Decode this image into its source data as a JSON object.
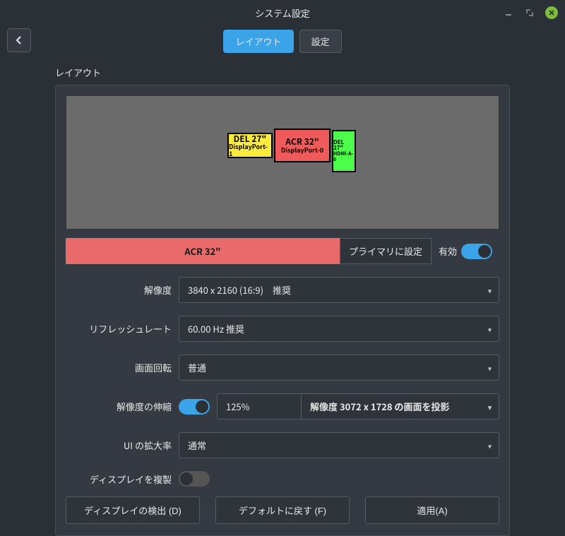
{
  "window": {
    "title": "システム設定"
  },
  "tabs": {
    "layout": "レイアウト",
    "settings": "設定",
    "back_aria": "戻る"
  },
  "section": {
    "layout_title": "レイアウト"
  },
  "monitors": {
    "del27_dp1": {
      "name": "DEL 27\"",
      "port": "DisplayPort-1"
    },
    "acr32": {
      "name": "ACR 32\"",
      "port": "DisplayPort-0"
    },
    "del27_hdmi": {
      "name": "DEL 27\"",
      "port": "HDMI-A-0"
    }
  },
  "selected": {
    "display": "ACR 32\"",
    "set_primary_label": "プライマリに設定",
    "enabled_label": "有効",
    "enabled": true
  },
  "form": {
    "resolution_label": "解像度",
    "resolution_value": "3840 x 2160 (16:9)　推奨",
    "refresh_label": "リフレッシュレート",
    "refresh_value": "60.00 Hz  推奨",
    "rotation_label": "画面回転",
    "rotation_value": "普通",
    "scale_label": "解像度の伸縮",
    "scale_enabled": true,
    "scale_pct": "125%",
    "scale_hint": "解像度 3072 x 1728 の画面を投影",
    "ui_scale_label": "UI の拡大率",
    "ui_scale_value": "通常",
    "duplicate_label": "ディスプレイを複製",
    "duplicate_enabled": false
  },
  "buttons": {
    "detect": "ディスプレイの検出 (D)",
    "defaults": "デフォルトに戻す (F)",
    "apply": "適用(A)"
  }
}
